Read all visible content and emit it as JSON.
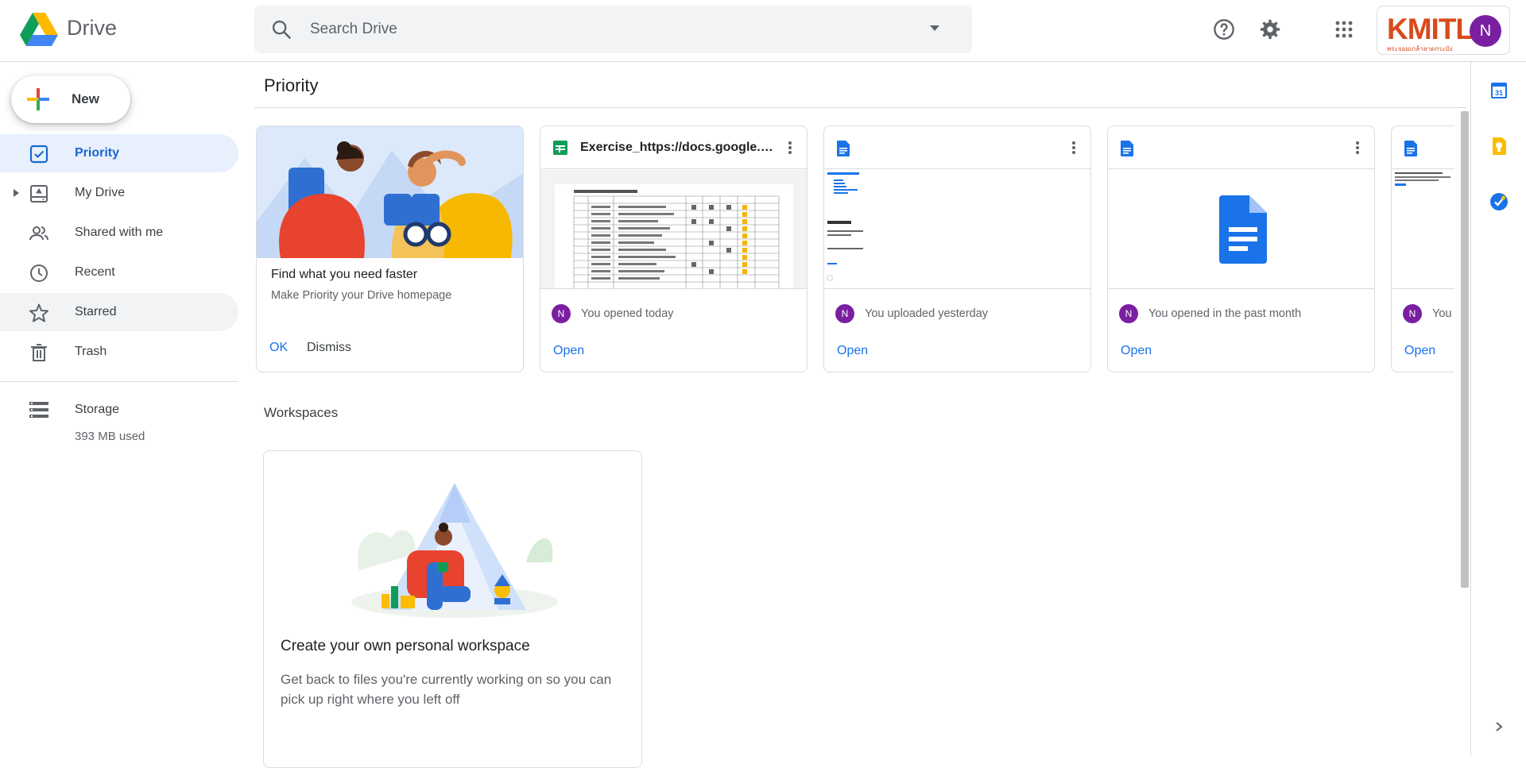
{
  "app": {
    "name": "Drive"
  },
  "search": {
    "placeholder": "Search Drive"
  },
  "header": {
    "brand_text": "KMITL",
    "brand_sub": "พระจอมเกล้าลาดกระบัง",
    "avatar_initial": "N"
  },
  "sidebar": {
    "new_label": "New",
    "items": [
      {
        "label": "Priority",
        "icon": "priority-check-icon",
        "state": "active"
      },
      {
        "label": "My Drive",
        "icon": "my-drive-icon",
        "state": "normal"
      },
      {
        "label": "Shared with me",
        "icon": "people-icon",
        "state": "normal"
      },
      {
        "label": "Recent",
        "icon": "clock-icon",
        "state": "normal"
      },
      {
        "label": "Starred",
        "icon": "star-icon",
        "state": "hover"
      },
      {
        "label": "Trash",
        "icon": "trash-icon",
        "state": "normal"
      }
    ],
    "storage": {
      "label": "Storage",
      "used": "393 MB used"
    }
  },
  "main": {
    "title": "Priority",
    "promo": {
      "title": "Find what you need faster",
      "subtitle": "Make Priority your Drive homepage",
      "ok": "OK",
      "dismiss": "Dismiss"
    },
    "cards": [
      {
        "name": "Exercise_https://docs.google.co...",
        "type": "sheets",
        "meta": "You opened today",
        "avatar": "N",
        "action": "Open"
      },
      {
        "name": "",
        "type": "docs",
        "meta": "You uploaded yesterday",
        "avatar": "N",
        "action": "Open"
      },
      {
        "name": "",
        "type": "docs",
        "meta": "You opened in the past month",
        "avatar": "N",
        "action": "Open"
      },
      {
        "name": "",
        "type": "docs",
        "meta": "You",
        "avatar": "N",
        "action": "Open"
      }
    ],
    "workspaces": {
      "title": "Workspaces",
      "card_title": "Create your own personal workspace",
      "card_text": "Get back to files you're currently working on so you can pick up right where you left off"
    }
  },
  "right_panel": {
    "calendar_day": "31"
  },
  "colors": {
    "accent": "#1a73e8",
    "active_bg": "#e8f0fe",
    "avatar": "#7b1fa2",
    "brand": "#d94a1b"
  }
}
